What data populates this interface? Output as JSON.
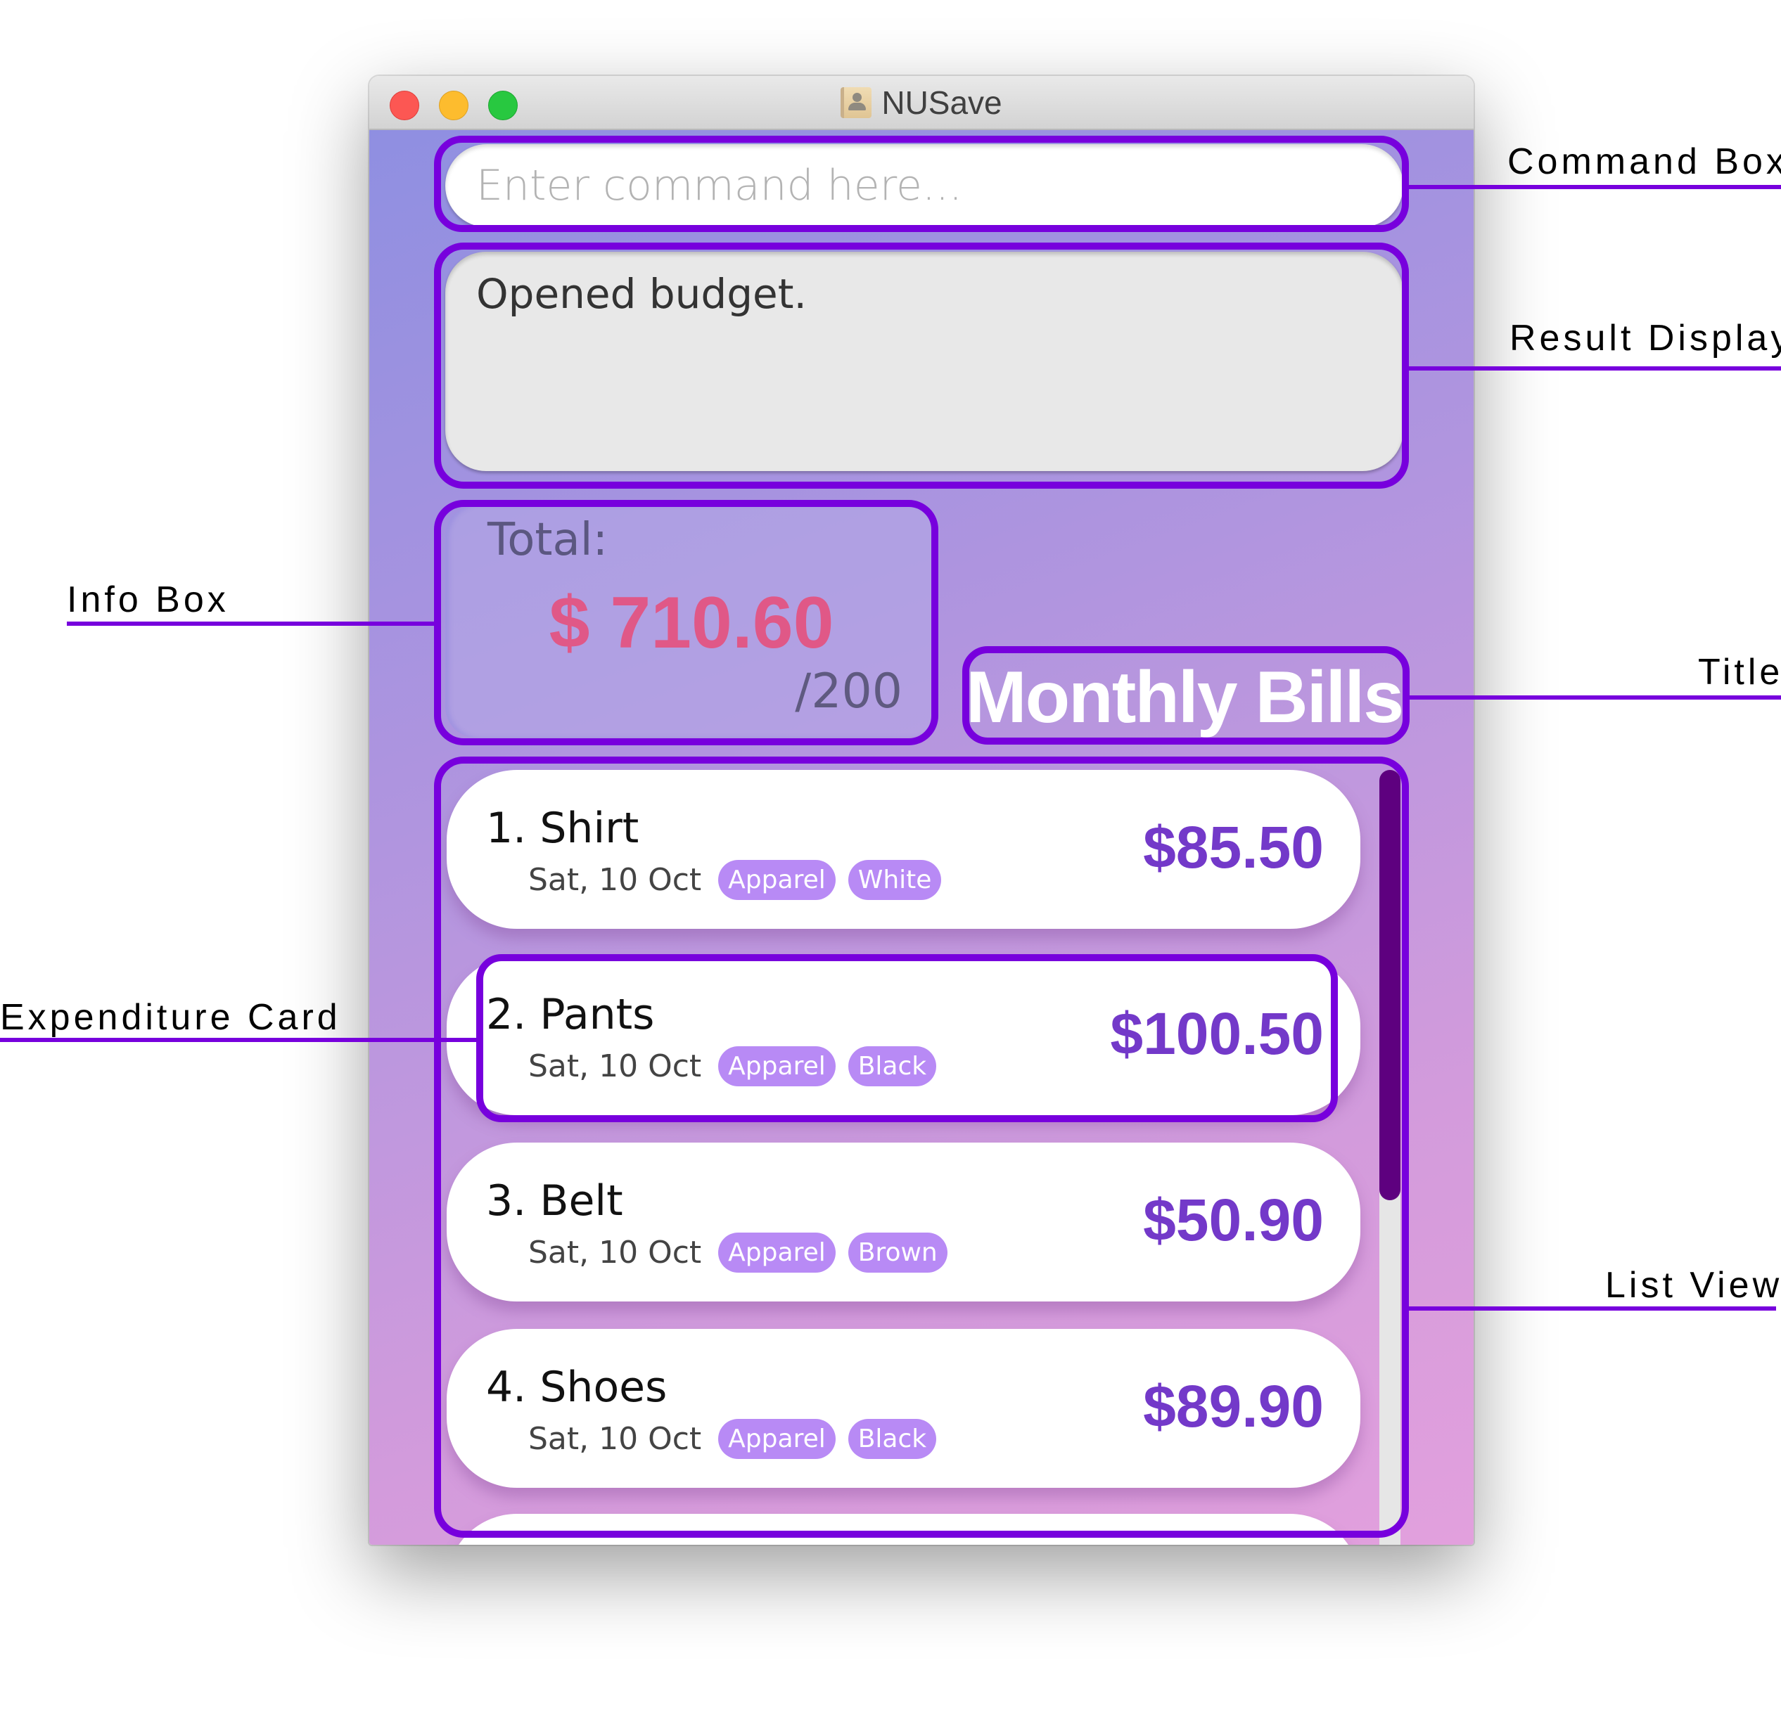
{
  "window": {
    "title": "NUSave",
    "controls": [
      "close",
      "minimize",
      "zoom"
    ],
    "app_icon": "contacts-book-icon"
  },
  "command_box": {
    "value": "",
    "placeholder": "Enter command here..."
  },
  "result_display": {
    "text": "Opened budget."
  },
  "info_box": {
    "label": "Total:",
    "total": "$ 710.60",
    "budget": "/200"
  },
  "title": {
    "text": "Monthly Bills"
  },
  "expenditures": [
    {
      "index": "1.",
      "name": "Shirt",
      "date": "Sat, 10 Oct",
      "tags": [
        "Apparel",
        "White"
      ],
      "amount": "$85.50"
    },
    {
      "index": "2.",
      "name": "Pants",
      "date": "Sat, 10 Oct",
      "tags": [
        "Apparel",
        "Black"
      ],
      "amount": "$100.50"
    },
    {
      "index": "3.",
      "name": "Belt",
      "date": "Sat, 10 Oct",
      "tags": [
        "Apparel",
        "Brown"
      ],
      "amount": "$50.90"
    },
    {
      "index": "4.",
      "name": "Shoes",
      "date": "Sat, 10 Oct",
      "tags": [
        "Apparel",
        "Black"
      ],
      "amount": "$89.90"
    }
  ],
  "annotations": {
    "command_box": "Command Box",
    "result_display": "Result Display",
    "info_box": "Info Box",
    "title": "Title",
    "expenditure_card": "Expenditure Card",
    "list_view": "List View"
  },
  "colors": {
    "annotation": "#7700dd",
    "amount": "#7339c9",
    "total": "#e05887",
    "tag": "#b88af5",
    "scroll_thumb": "#5e007f"
  }
}
